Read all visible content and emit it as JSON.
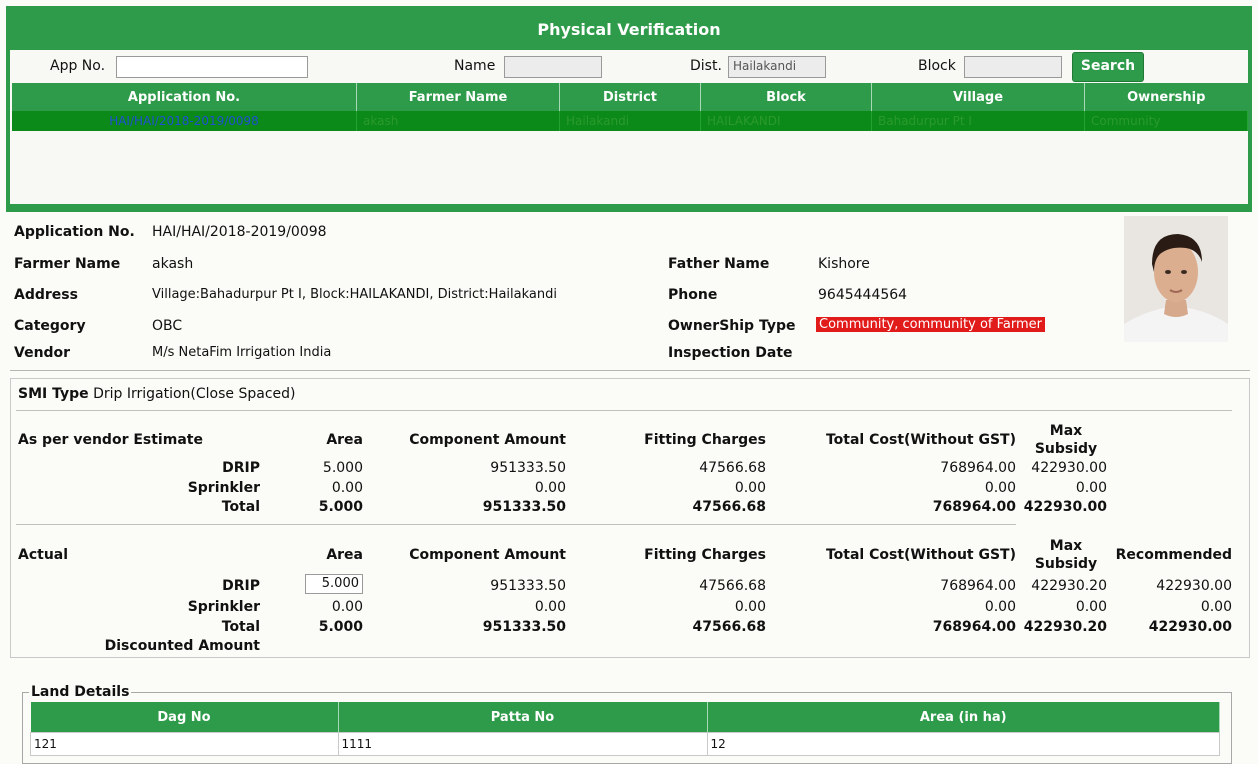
{
  "title": "Physical Verification",
  "search": {
    "app_no_label": "App No.",
    "app_no_value": "",
    "name_label": "Name",
    "name_value": "",
    "dist_label": "Dist.",
    "dist_value": "Hailakandi",
    "block_label": "Block",
    "block_value": "",
    "button": "Search"
  },
  "grid": {
    "headers": [
      "Application No.",
      "Farmer Name",
      "District",
      "Block",
      "Village",
      "Ownership"
    ],
    "rows": [
      [
        "HAI/HAI/2018-2019/0098",
        "akash",
        "Hailakandi",
        "HAILAKANDI",
        "Bahadurpur Pt I",
        "Community"
      ]
    ]
  },
  "details": {
    "app_no_label": "Application No.",
    "app_no": "HAI/HAI/2018-2019/0098",
    "farmer_label": "Farmer Name",
    "farmer": "akash",
    "father_label": "Father Name",
    "father": "Kishore",
    "address_label": "Address",
    "address": "Village:Bahadurpur Pt I, Block:HAILAKANDI, District:Hailakandi",
    "phone_label": "Phone",
    "phone": "9645444564",
    "category_label": "Category",
    "category": "OBC",
    "ownership_label": "OwnerShip Type",
    "ownership": "Community, community of Farmer",
    "vendor_label": "Vendor",
    "vendor": "M/s NetaFim Irrigation India",
    "inspection_label": "Inspection Date",
    "inspection": ""
  },
  "smi": {
    "type_label": "SMI Type",
    "type_value": "Drip Irrigation(Close Spaced)",
    "estimate": {
      "heading": "As per vendor Estimate",
      "cols": [
        "Area",
        "Component Amount",
        "Fitting Charges",
        "Total Cost(Without GST)",
        "Max Subsidy"
      ],
      "rows": [
        {
          "label": "DRIP",
          "area": "5.000",
          "comp": "951333.50",
          "fit": "47566.68",
          "total": "768964.00",
          "max": "422930.00"
        },
        {
          "label": "Sprinkler",
          "area": "0.00",
          "comp": "0.00",
          "fit": "0.00",
          "total": "0.00",
          "max": "0.00"
        },
        {
          "label": "Total",
          "area": "5.000",
          "comp": "951333.50",
          "fit": "47566.68",
          "total": "768964.00",
          "max": "422930.00"
        }
      ]
    },
    "actual": {
      "heading": "Actual",
      "cols": [
        "Area",
        "Component Amount",
        "Fitting Charges",
        "Total Cost(Without GST)",
        "Max Subsidy",
        "Recommended"
      ],
      "rows": [
        {
          "label": "DRIP",
          "area": "5.000",
          "comp": "951333.50",
          "fit": "47566.68",
          "total": "768964.00",
          "max": "422930.20",
          "rec": "422930.00"
        },
        {
          "label": "Sprinkler",
          "area": "0.00",
          "comp": "0.00",
          "fit": "0.00",
          "total": "0.00",
          "max": "0.00",
          "rec": "0.00"
        },
        {
          "label": "Total",
          "area": "5.000",
          "comp": "951333.50",
          "fit": "47566.68",
          "total": "768964.00",
          "max": "422930.20",
          "rec": "422930.00"
        }
      ],
      "discounted_label": "Discounted Amount"
    }
  },
  "land": {
    "legend": "Land Details",
    "headers": [
      "Dag No",
      "Patta No",
      "Area (in ha)"
    ],
    "rows": [
      [
        "121",
        "1111",
        "12"
      ]
    ]
  },
  "colors": {
    "accent": "#2e9b4a",
    "row_selected": "#0b8a1a",
    "highlight": "#e11a1a"
  }
}
